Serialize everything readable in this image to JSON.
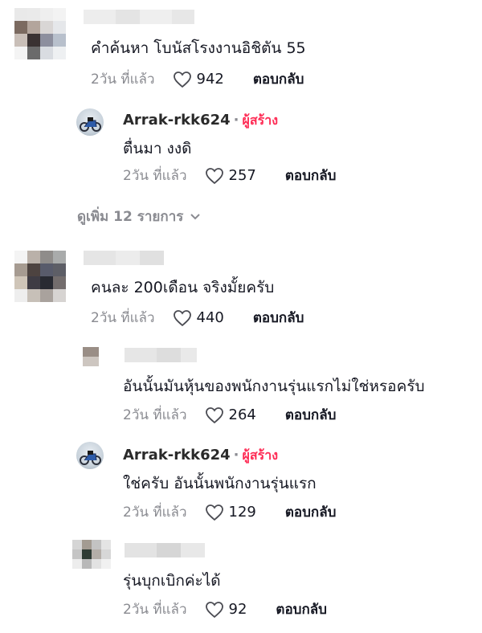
{
  "comments": [
    {
      "text": "คำค้นหา โบนัสโรงงานอิชิตัน 55",
      "time": "2วัน ที่แล้ว",
      "likes": "942",
      "reply": "ตอบกลับ",
      "replies": [
        {
          "username": "Arrak-rkk624",
          "dot": "·",
          "badge": "ผู้สร้าง",
          "text": "ตื่นมา งงดิ",
          "time": "2วัน ที่แล้ว",
          "likes": "257",
          "reply": "ตอบกลับ"
        }
      ],
      "view_more": "ดูเพิ่ม 12 รายการ"
    },
    {
      "text": "คนละ 200เดือน จริงมั้ยครับ",
      "time": "2วัน ที่แล้ว",
      "likes": "440",
      "reply": "ตอบกลับ",
      "replies": [
        {
          "text": "อันนั้นมันหุ้นของพนักงานรุ่นแรกไม่ใช่หรอครับ",
          "time": "2วัน ที่แล้ว",
          "likes": "264",
          "reply": "ตอบกลับ"
        },
        {
          "username": "Arrak-rkk624",
          "dot": "·",
          "badge": "ผู้สร้าง",
          "text": "ใช่ครับ อันนั้นพนักงานรุ่นแรก",
          "time": "2วัน ที่แล้ว",
          "likes": "129",
          "reply": "ตอบกลับ"
        },
        {
          "text": "รุ่นบุกเบิกค่ะได้",
          "time": "2วัน ที่แล้ว",
          "likes": "92",
          "reply": "ตอบกลับ"
        }
      ]
    }
  ],
  "icons": {
    "like": "heart-outline-icon",
    "expand": "chevron-down-icon"
  },
  "colors": {
    "creator_badge": "#fe2c55",
    "muted": "#8a8b91",
    "text": "#161823"
  }
}
